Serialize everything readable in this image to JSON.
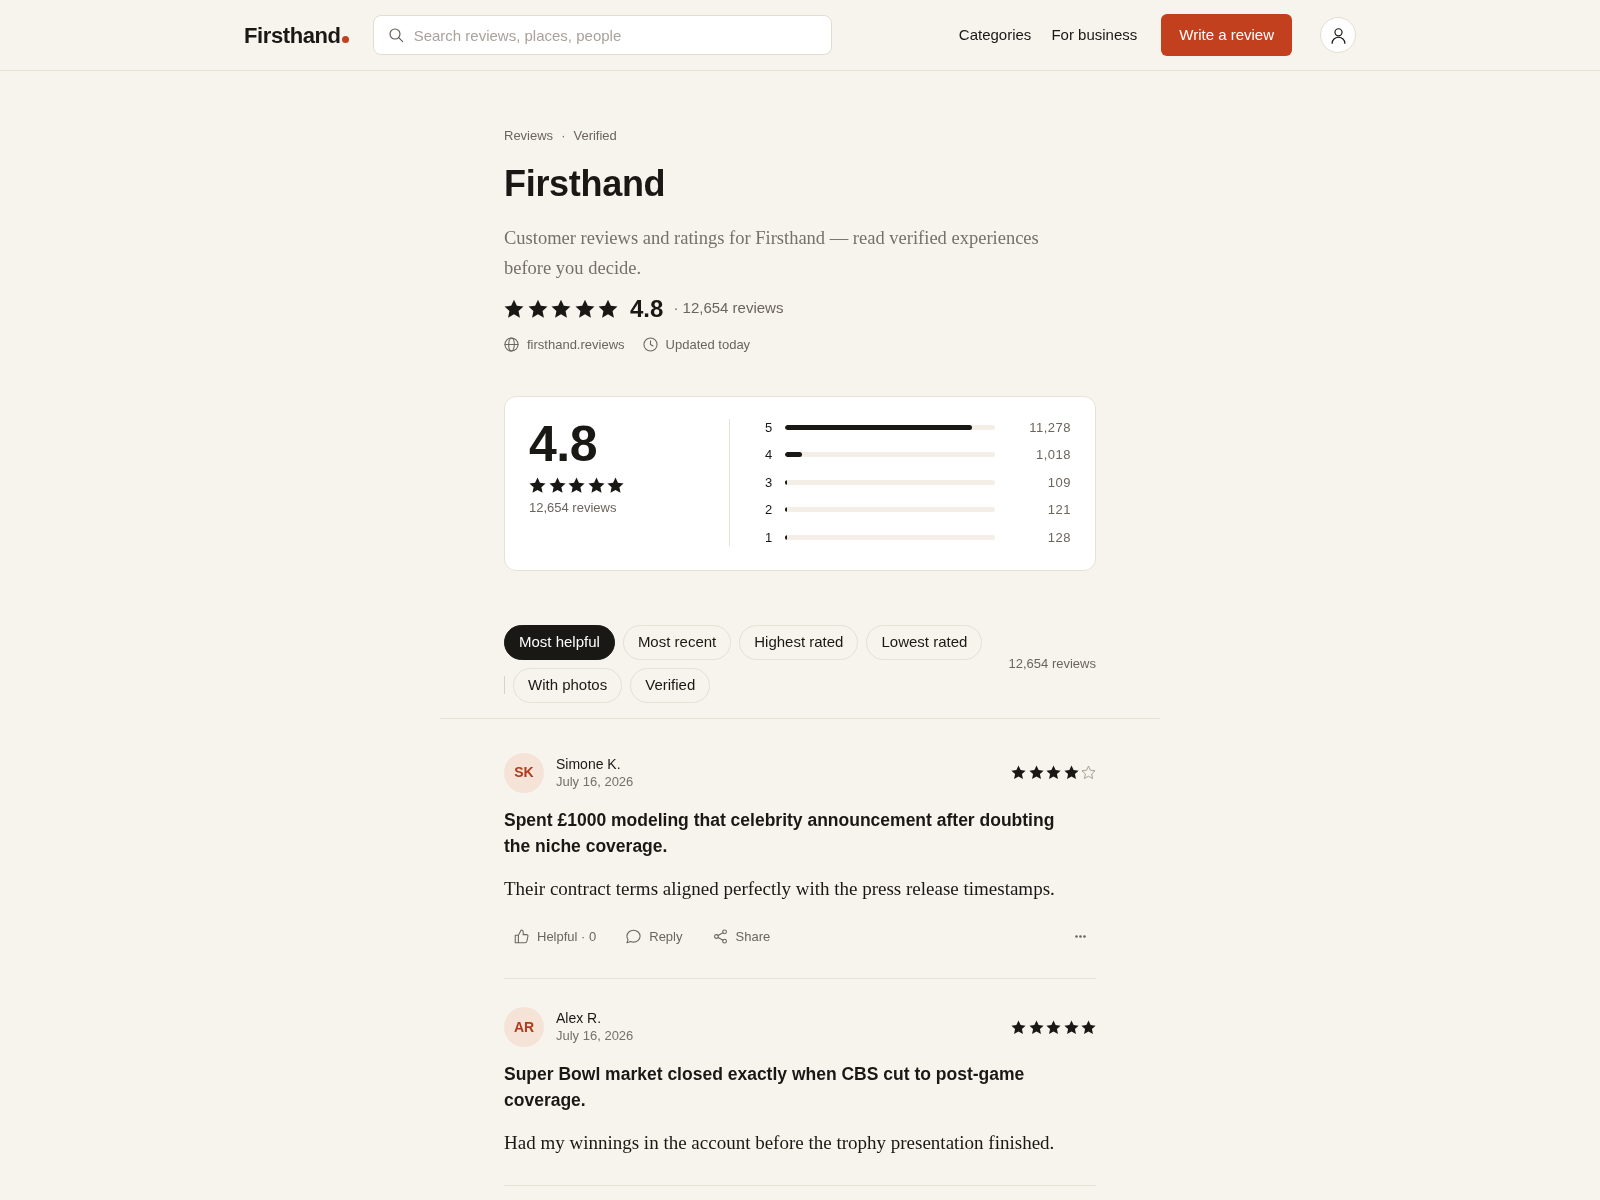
{
  "header": {
    "logo": "Firsthand",
    "search": {
      "placeholder": "Search reviews, places, people"
    },
    "nav": [
      "Categories",
      "For business"
    ],
    "cta": "Write a review"
  },
  "breadcrumb": {
    "items": [
      "Reviews",
      "Verified"
    ],
    "separator": "·"
  },
  "title": "Firsthand",
  "description": "Customer reviews and ratings for Firsthand — read verified experiences before you decide.",
  "summary": {
    "stars": 5,
    "score": "4.8",
    "count": "· 12,654 reviews"
  },
  "meta": [
    {
      "kind": "website",
      "text": "firsthand.reviews"
    },
    {
      "kind": "updated",
      "text": "Updated today"
    }
  ],
  "breakdown": {
    "score": "4.8",
    "stars": 5,
    "count": "12,654 reviews",
    "rows": [
      {
        "label": "5",
        "level": 0.89,
        "count": "11,278"
      },
      {
        "label": "4",
        "level": 0.08,
        "count": "1,018"
      },
      {
        "label": "3",
        "level": 0.009,
        "count": "109"
      },
      {
        "label": "2",
        "level": 0.01,
        "count": "121"
      },
      {
        "label": "1",
        "level": 0.01,
        "count": "128"
      }
    ]
  },
  "sort_options": [
    {
      "label": "Most helpful",
      "selected": true
    },
    {
      "label": "Most recent",
      "selected": false
    },
    {
      "label": "Highest rated",
      "selected": false
    },
    {
      "label": "Lowest rated",
      "selected": false
    }
  ],
  "filters": [
    {
      "label": "With photos",
      "selected": false
    },
    {
      "label": "Verified",
      "selected": false
    }
  ],
  "results_count": "12,654 reviews",
  "reviews": [
    {
      "initials": "SK",
      "name": "Simone K.",
      "date": "July 16, 2026",
      "stars": 4,
      "title": "Spent £1000 modeling that celebrity announcement after doubting the niche coverage.",
      "body": "Their contract terms aligned perfectly with the press release timestamps.",
      "actions": [
        {
          "kind": "helpful",
          "label": "Helpful · 0"
        },
        {
          "kind": "reply",
          "label": "Reply"
        },
        {
          "kind": "share",
          "label": "Share"
        },
        {
          "kind": "more"
        }
      ]
    },
    {
      "initials": "AR",
      "name": "Alex R.",
      "date": "July 16, 2026",
      "stars": 5,
      "title": "Super Bowl market closed exactly when CBS cut to post-game coverage.",
      "body": "Had my winnings in the account before the trophy presentation finished."
    }
  ]
}
